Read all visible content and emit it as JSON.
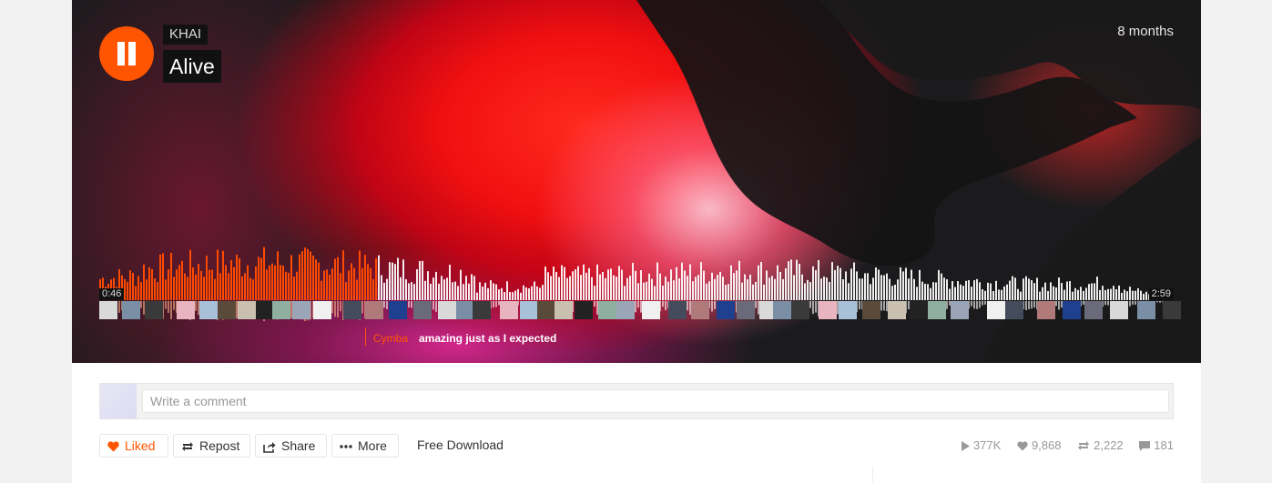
{
  "track": {
    "artist": "KHAI",
    "title": "Alive",
    "posted_ago": "8 months",
    "current_time": "0:46",
    "duration": "2:59",
    "progress": 0.257
  },
  "timed_comment": {
    "user": "Cymba",
    "text": "amazing just as I expected"
  },
  "comment_box": {
    "placeholder": "Write a comment"
  },
  "actions": {
    "liked": "Liked",
    "repost": "Repost",
    "share": "Share",
    "more": "More",
    "free_download": "Free Download"
  },
  "stats": {
    "plays": "377K",
    "likes": "9,868",
    "reposts": "2,222",
    "comments": "181"
  },
  "colors": {
    "accent": "#ff5500",
    "played": "#ff4a00",
    "unplayed": "#ffffff"
  }
}
